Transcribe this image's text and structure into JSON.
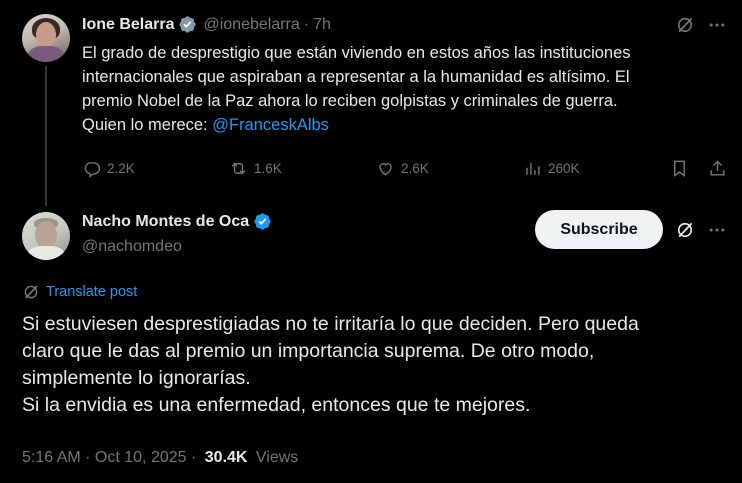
{
  "parent_tweet": {
    "author_name": "Ione Belarra",
    "handle": "@ionebelarra",
    "separator": "·",
    "time": "7h",
    "text_lines": [
      "El grado de desprestigio que están viviendo en estos años las instituciones",
      "internacionales que aspiraban a representar a la humanidad es altísimo. El",
      "premio Nobel de la Paz ahora lo reciben golpistas y criminales de guerra.",
      "Quien lo merece: "
    ],
    "mention": "@FranceskAlbs",
    "replies": "2.2K",
    "reposts": "1.6K",
    "likes": "2.6K",
    "views": "260K"
  },
  "reply_tweet": {
    "author_name": "Nacho Montes de Oca",
    "handle": "@nachomdeo",
    "subscribe_label": "Subscribe",
    "translate_label": "Translate post",
    "text_lines": [
      "Si estuviesen desprestigiadas no te irritaría lo que deciden. Pero queda",
      "claro que le das al premio un importancia suprema. De otro modo,",
      "simplemente lo ignorarías.",
      "Si la envidia es una enfermedad, entonces que te mejores."
    ],
    "timestamp": "5:16 AM · Oct 10, 2025 · ",
    "views_count": "30.4K",
    "views_label": " Views"
  },
  "colors": {
    "background": "#000000",
    "text": "#e7e9ea",
    "muted": "#71767b",
    "accent": "#1d9bf0",
    "subscribe_bg": "#eff3f4"
  },
  "icons": [
    "verified-badge-icon",
    "grok-icon",
    "more-icon",
    "reply-icon",
    "repost-icon",
    "like-icon",
    "views-icon",
    "bookmark-icon",
    "share-icon",
    "translate-icon"
  ]
}
